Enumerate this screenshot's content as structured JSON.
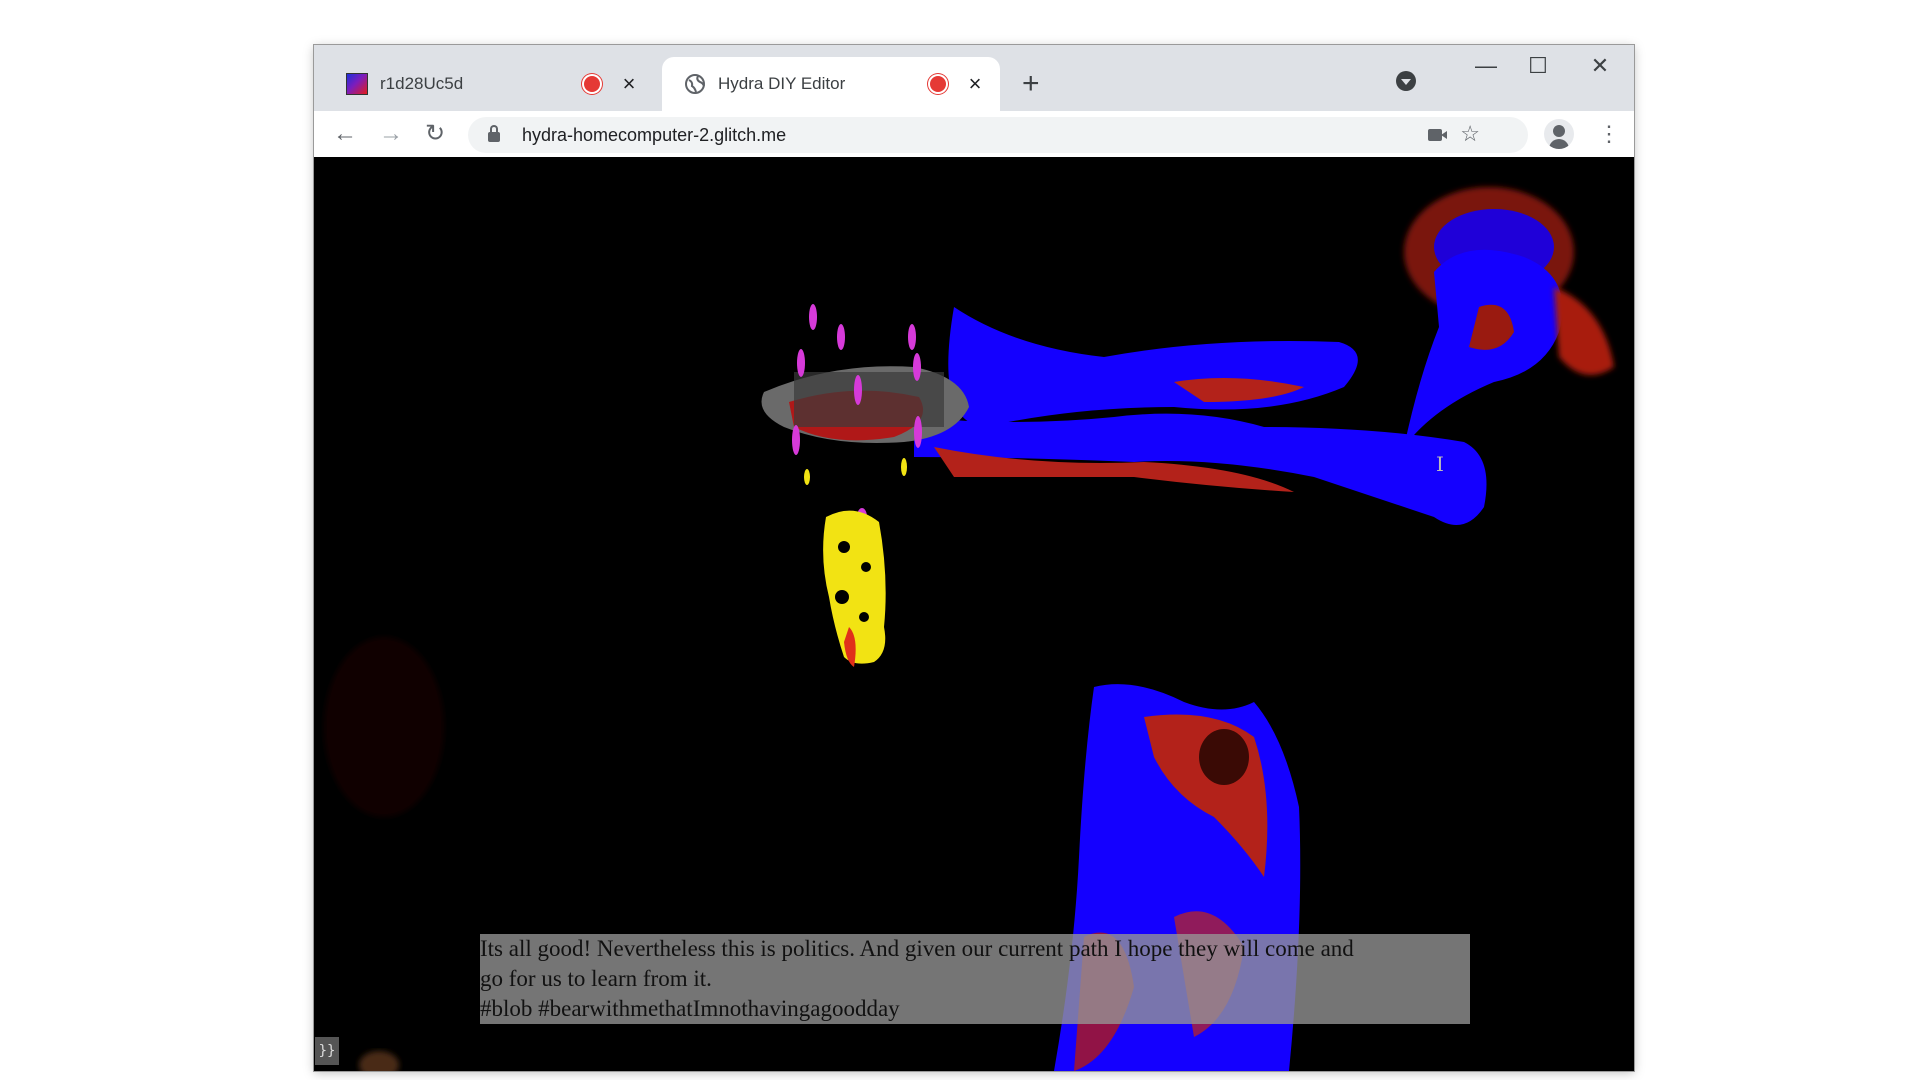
{
  "browser": {
    "tabs": [
      {
        "title": "r1d28Uc5d",
        "recording": true,
        "active": false,
        "favicon": "gradient-thumbnail-icon"
      },
      {
        "title": "Hydra DIY Editor",
        "recording": true,
        "active": true,
        "favicon": "globe-icon"
      }
    ],
    "new_tab_icon": "plus-icon",
    "address": "hydra-homecomputer-2.glitch.me",
    "nav_icons": [
      "back-arrow-icon",
      "forward-arrow-icon",
      "reload-icon"
    ],
    "toolbar_icons": [
      "camera-icon",
      "star-icon",
      "profile-icon",
      "kebab-menu-icon"
    ],
    "window_controls": [
      "minimize-icon",
      "maximize-icon",
      "close-icon"
    ]
  },
  "canvas": {
    "caption_lines": [
      "Its all good! Nevertheless this is politics. And given our current path I hope they will come and",
      "go for us to learn from it.",
      "#blob #bearwithmethatImnothavingagoodday"
    ],
    "toggle_label": "}}"
  },
  "colors": {
    "tab_strip": "#dee1e6",
    "visual_blue": "#1400ff",
    "visual_red": "#c21c10",
    "visual_yellow": "#f2e313",
    "visual_magenta": "#d63ad9"
  }
}
